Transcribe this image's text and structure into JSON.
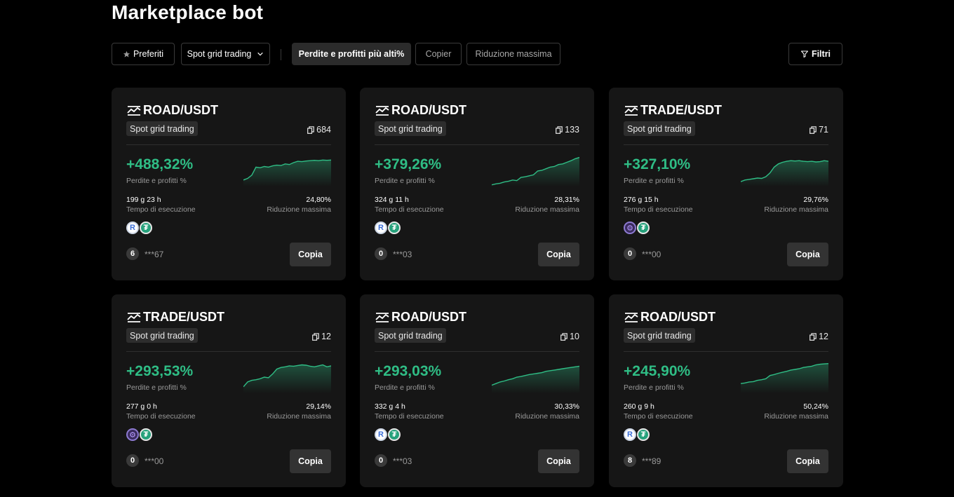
{
  "page": {
    "title": "Marketplace bot"
  },
  "toolbar": {
    "favorites_label": "Preferiti",
    "strategy_select": "Spot grid trading",
    "sort_pnl_label": "Perdite e profitti più alti%",
    "sort_copier_label": "Copier",
    "sort_drawdown_label": "Riduzione massima",
    "filters_label": "Filtri"
  },
  "colors": {
    "positive": "#2fbd85",
    "card_bg": "#161616",
    "page_bg": "#000000"
  },
  "cards": [
    {
      "pair": "ROAD/USDT",
      "strategy": "Spot grid trading",
      "copiers": "684",
      "pnl": "+488,32%",
      "pnl_label": "Perdite e profitti %",
      "runtime": "199 g 23 h",
      "runtime_label": "Tempo di esecuzione",
      "drawdown": "24,80%",
      "drawdown_label": "Riduzione massima",
      "base_coin": "road",
      "base_coin_icon": "road-coin-icon",
      "rank": "6",
      "user": "***67",
      "copy_label": "Copia",
      "trend": [
        0.2,
        0.25,
        0.35,
        0.6,
        0.58,
        0.62,
        0.6,
        0.64,
        0.66,
        0.65,
        0.7,
        0.68,
        0.74,
        0.78,
        0.77,
        0.79,
        0.8,
        0.81,
        0.8,
        0.82,
        0.81,
        0.82
      ]
    },
    {
      "pair": "ROAD/USDT",
      "strategy": "Spot grid trading",
      "copiers": "133",
      "pnl": "+379,26%",
      "pnl_label": "Perdite e profitti %",
      "runtime": "324 g 11 h",
      "runtime_label": "Tempo di esecuzione",
      "drawdown": "28,31%",
      "drawdown_label": "Riduzione massima",
      "base_coin": "road",
      "base_coin_icon": "road-coin-icon",
      "rank": "0",
      "user": "***03",
      "copy_label": "Copia",
      "trend": [
        0.05,
        0.08,
        0.1,
        0.14,
        0.16,
        0.2,
        0.18,
        0.28,
        0.3,
        0.33,
        0.36,
        0.48,
        0.5,
        0.55,
        0.6,
        0.62,
        0.68,
        0.7,
        0.75,
        0.8,
        0.86,
        0.9
      ]
    },
    {
      "pair": "TRADE/USDT",
      "strategy": "Spot grid trading",
      "copiers": "71",
      "pnl": "+327,10%",
      "pnl_label": "Perdite e profitti %",
      "runtime": "276 g 15 h",
      "runtime_label": "Tempo di esecuzione",
      "drawdown": "29,76%",
      "drawdown_label": "Riduzione massima",
      "base_coin": "trade",
      "base_coin_icon": "trade-coin-icon",
      "rank": "0",
      "user": "***00",
      "copy_label": "Copia",
      "trend": [
        0.15,
        0.2,
        0.22,
        0.24,
        0.26,
        0.25,
        0.3,
        0.42,
        0.6,
        0.7,
        0.75,
        0.78,
        0.8,
        0.79,
        0.8,
        0.78,
        0.77,
        0.78,
        0.76,
        0.77,
        0.8,
        0.78
      ]
    },
    {
      "pair": "TRADE/USDT",
      "strategy": "Spot grid trading",
      "copiers": "12",
      "pnl": "+293,53%",
      "pnl_label": "Perdite e profitti %",
      "runtime": "277 g 0 h",
      "runtime_label": "Tempo di esecuzione",
      "drawdown": "29,14%",
      "drawdown_label": "Riduzione massima",
      "base_coin": "trade",
      "base_coin_icon": "trade-coin-icon",
      "rank": "0",
      "user": "***00",
      "copy_label": "Copia",
      "trend": [
        0.2,
        0.35,
        0.4,
        0.42,
        0.45,
        0.5,
        0.48,
        0.6,
        0.75,
        0.8,
        0.82,
        0.85,
        0.84,
        0.86,
        0.88,
        0.87,
        0.84,
        0.82,
        0.85,
        0.88,
        0.82,
        0.85
      ]
    },
    {
      "pair": "ROAD/USDT",
      "strategy": "Spot grid trading",
      "copiers": "10",
      "pnl": "+293,03%",
      "pnl_label": "Perdite e profitti %",
      "runtime": "332 g 4 h",
      "runtime_label": "Tempo di esecuzione",
      "drawdown": "30,33%",
      "drawdown_label": "Riduzione massima",
      "base_coin": "road",
      "base_coin_icon": "road-coin-icon",
      "rank": "0",
      "user": "***03",
      "copy_label": "Copia",
      "trend": [
        0.25,
        0.3,
        0.35,
        0.38,
        0.42,
        0.45,
        0.5,
        0.52,
        0.55,
        0.58,
        0.6,
        0.62,
        0.64,
        0.68,
        0.7,
        0.72,
        0.74,
        0.76,
        0.78,
        0.8,
        0.82,
        0.84
      ]
    },
    {
      "pair": "ROAD/USDT",
      "strategy": "Spot grid trading",
      "copiers": "12",
      "pnl": "+245,90%",
      "pnl_label": "Perdite e profitti %",
      "runtime": "260 g 9 h",
      "runtime_label": "Tempo di esecuzione",
      "drawdown": "50,24%",
      "drawdown_label": "Riduzione massima",
      "base_coin": "road",
      "base_coin_icon": "road-coin-icon",
      "rank": "8",
      "user": "***89",
      "copy_label": "Copia",
      "trend": [
        0.3,
        0.32,
        0.35,
        0.36,
        0.4,
        0.42,
        0.45,
        0.55,
        0.58,
        0.62,
        0.65,
        0.68,
        0.72,
        0.74,
        0.76,
        0.8,
        0.82,
        0.84,
        0.88,
        0.9,
        0.91,
        0.92
      ]
    }
  ]
}
